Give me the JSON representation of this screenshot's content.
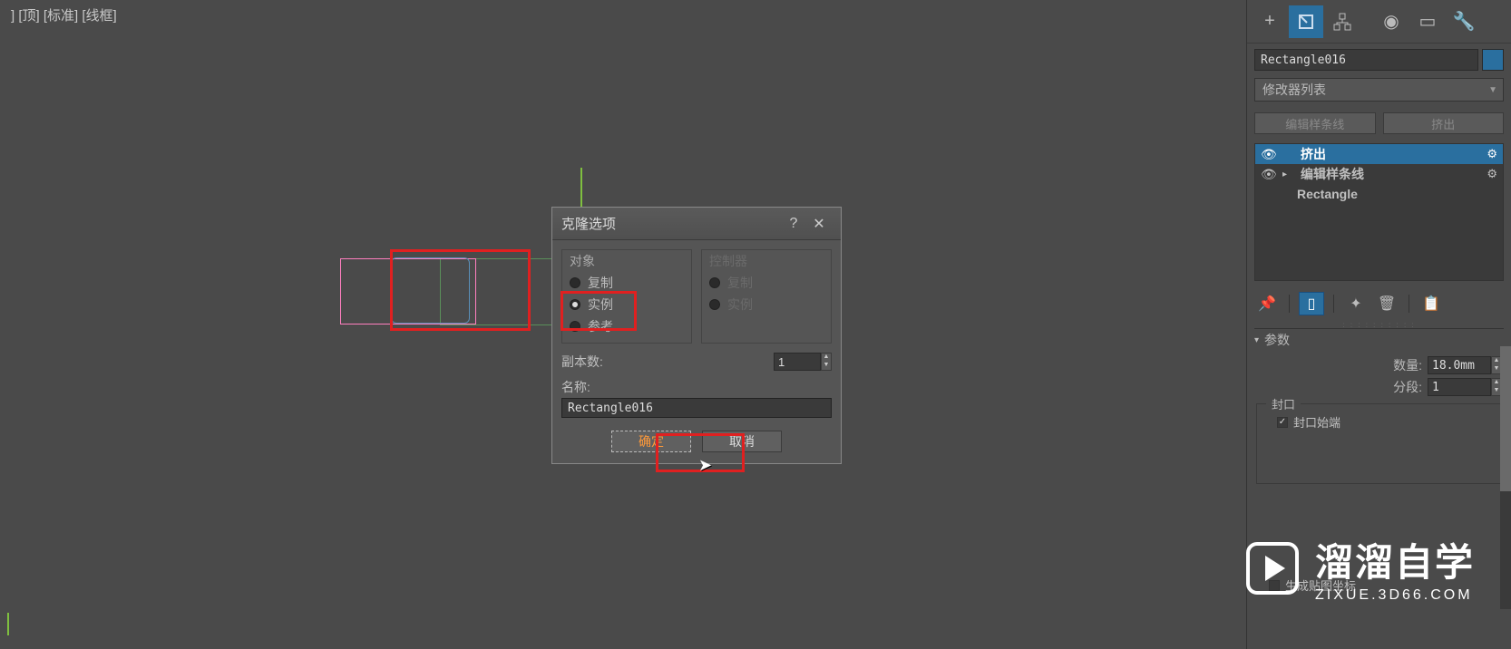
{
  "viewport": {
    "label": "] [顶] [标准] [线框]"
  },
  "dialog": {
    "title": "克隆选项",
    "object": {
      "legend": "对象",
      "copy": "复制",
      "instance": "实例",
      "reference": "参考",
      "selected": "instance"
    },
    "controller": {
      "legend": "控制器",
      "copy": "复制",
      "instance": "实例"
    },
    "copies_label": "副本数:",
    "copies_value": "1",
    "name_label": "名称:",
    "name_value": "Rectangle016",
    "ok": "确定",
    "cancel": "取消"
  },
  "panel": {
    "obj_name": "Rectangle016",
    "modifier_list": "修改器列表",
    "quick1": "编辑样条线",
    "quick2": "挤出",
    "stack": {
      "extrude": "挤出",
      "edit_spline": "编辑样条线",
      "base": "Rectangle"
    },
    "rollout_title": "参数",
    "amount_label": "数量:",
    "amount_value": "18.0mm",
    "segments_label": "分段:",
    "segments_value": "1",
    "cap_legend": "封口",
    "cap_start": "封口始端",
    "gen_uv": "生成贴图坐标"
  },
  "watermark": {
    "big": "溜溜自学",
    "sm": "ZIXUE.3D66.COM"
  }
}
